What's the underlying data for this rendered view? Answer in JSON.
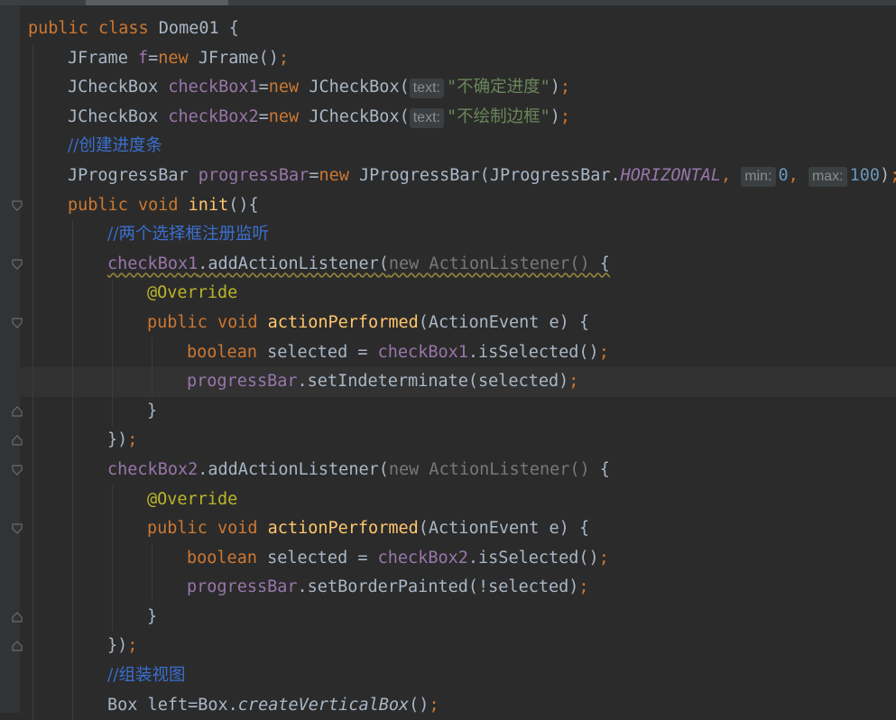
{
  "editor": {
    "lines": [
      {
        "indent": 0,
        "fold": "",
        "caret": false,
        "tokens": [
          {
            "t": "public ",
            "c": "kw"
          },
          {
            "t": "class ",
            "c": "kw"
          },
          {
            "t": "Dome01 {",
            "c": ""
          }
        ]
      },
      {
        "indent": 1,
        "fold": "",
        "caret": false,
        "tokens": [
          {
            "t": "JFrame ",
            "c": ""
          },
          {
            "t": "f",
            "c": "fld"
          },
          {
            "t": "=",
            "c": ""
          },
          {
            "t": "new ",
            "c": "kw"
          },
          {
            "t": "JFrame()",
            "c": ""
          },
          {
            "t": ";",
            "c": "kw"
          }
        ]
      },
      {
        "indent": 1,
        "fold": "",
        "caret": false,
        "tokens": [
          {
            "t": "JCheckBox ",
            "c": ""
          },
          {
            "t": "checkBox1",
            "c": "fld"
          },
          {
            "t": "=",
            "c": ""
          },
          {
            "t": "new ",
            "c": "kw"
          },
          {
            "t": "JCheckBox(",
            "c": ""
          },
          {
            "t": "text:",
            "c": "hint"
          },
          {
            "t": "\"不确定进度\"",
            "c": "str"
          },
          {
            "t": ")",
            "c": ""
          },
          {
            "t": ";",
            "c": "kw"
          }
        ]
      },
      {
        "indent": 1,
        "fold": "",
        "caret": false,
        "tokens": [
          {
            "t": "JCheckBox ",
            "c": ""
          },
          {
            "t": "checkBox2",
            "c": "fld"
          },
          {
            "t": "=",
            "c": ""
          },
          {
            "t": "new ",
            "c": "kw"
          },
          {
            "t": "JCheckBox(",
            "c": ""
          },
          {
            "t": "text:",
            "c": "hint"
          },
          {
            "t": "\"不绘制边框\"",
            "c": "str"
          },
          {
            "t": ")",
            "c": ""
          },
          {
            "t": ";",
            "c": "kw"
          }
        ]
      },
      {
        "indent": 1,
        "fold": "",
        "caret": false,
        "tokens": [
          {
            "t": "//",
            "c": "cmt"
          },
          {
            "t": "创建进度条",
            "c": "cmt"
          }
        ]
      },
      {
        "indent": 1,
        "fold": "",
        "caret": false,
        "tokens": [
          {
            "t": "JProgressBar ",
            "c": ""
          },
          {
            "t": "progressBar",
            "c": "fld"
          },
          {
            "t": "=",
            "c": ""
          },
          {
            "t": "new ",
            "c": "kw"
          },
          {
            "t": "JProgressBar(JProgressBar.",
            "c": ""
          },
          {
            "t": "HORIZONTAL",
            "c": "fld ital"
          },
          {
            "t": ", ",
            "c": "kw"
          },
          {
            "t": "min:",
            "c": "hint"
          },
          {
            "t": "0",
            "c": "num"
          },
          {
            "t": ", ",
            "c": "kw"
          },
          {
            "t": "max:",
            "c": "hint"
          },
          {
            "t": "100",
            "c": "num"
          },
          {
            "t": ")",
            "c": ""
          },
          {
            "t": ";",
            "c": "kw"
          }
        ]
      },
      {
        "indent": 1,
        "fold": "open",
        "caret": false,
        "tokens": [
          {
            "t": "public ",
            "c": "kw"
          },
          {
            "t": "void ",
            "c": "kw"
          },
          {
            "t": "init",
            "c": "fn"
          },
          {
            "t": "(){",
            "c": ""
          }
        ]
      },
      {
        "indent": 2,
        "fold": "",
        "caret": false,
        "tokens": [
          {
            "t": "//",
            "c": "cmt"
          },
          {
            "t": "两个选择框注册监听",
            "c": "cmt"
          }
        ]
      },
      {
        "indent": 2,
        "fold": "open",
        "caret": false,
        "tokens": [
          {
            "t": "checkBox1",
            "c": "fld warn"
          },
          {
            "t": ".addActionListener(",
            "c": "warn"
          },
          {
            "t": "new ActionListener() ",
            "c": "grey warn"
          },
          {
            "t": "{",
            "c": "warn"
          }
        ]
      },
      {
        "indent": 3,
        "fold": "",
        "caret": false,
        "tokens": [
          {
            "t": "@Override",
            "c": "ann"
          }
        ]
      },
      {
        "indent": 3,
        "fold": "open",
        "caret": false,
        "tokens": [
          {
            "t": "public ",
            "c": "kw"
          },
          {
            "t": "void ",
            "c": "kw"
          },
          {
            "t": "actionPerformed",
            "c": "fn"
          },
          {
            "t": "(ActionEvent e) {",
            "c": ""
          }
        ]
      },
      {
        "indent": 4,
        "fold": "",
        "caret": false,
        "tokens": [
          {
            "t": "boolean ",
            "c": "kw"
          },
          {
            "t": "selected = ",
            "c": ""
          },
          {
            "t": "checkBox1",
            "c": "fld"
          },
          {
            "t": ".isSelected()",
            "c": ""
          },
          {
            "t": ";",
            "c": "kw"
          }
        ]
      },
      {
        "indent": 4,
        "fold": "",
        "caret": true,
        "tokens": [
          {
            "t": "progressBar",
            "c": "fld"
          },
          {
            "t": ".setIndeterminate(selected)",
            "c": ""
          },
          {
            "t": ";",
            "c": "kw"
          }
        ]
      },
      {
        "indent": 3,
        "fold": "close",
        "caret": false,
        "tokens": [
          {
            "t": "}",
            "c": ""
          }
        ]
      },
      {
        "indent": 2,
        "fold": "close",
        "caret": false,
        "tokens": [
          {
            "t": "})",
            "c": ""
          },
          {
            "t": ";",
            "c": "kw"
          }
        ]
      },
      {
        "indent": 2,
        "fold": "open",
        "caret": false,
        "tokens": [
          {
            "t": "checkBox2",
            "c": "fld"
          },
          {
            "t": ".addActionListener(",
            "c": ""
          },
          {
            "t": "new ActionListener() ",
            "c": "grey"
          },
          {
            "t": "{",
            "c": ""
          }
        ]
      },
      {
        "indent": 3,
        "fold": "",
        "caret": false,
        "tokens": [
          {
            "t": "@Override",
            "c": "ann"
          }
        ]
      },
      {
        "indent": 3,
        "fold": "open",
        "caret": false,
        "tokens": [
          {
            "t": "public ",
            "c": "kw"
          },
          {
            "t": "void ",
            "c": "kw"
          },
          {
            "t": "actionPerformed",
            "c": "fn"
          },
          {
            "t": "(ActionEvent e) {",
            "c": ""
          }
        ]
      },
      {
        "indent": 4,
        "fold": "",
        "caret": false,
        "tokens": [
          {
            "t": "boolean ",
            "c": "kw"
          },
          {
            "t": "selected = ",
            "c": ""
          },
          {
            "t": "checkBox2",
            "c": "fld"
          },
          {
            "t": ".isSelected()",
            "c": ""
          },
          {
            "t": ";",
            "c": "kw"
          }
        ]
      },
      {
        "indent": 4,
        "fold": "",
        "caret": false,
        "tokens": [
          {
            "t": "progressBar",
            "c": "fld"
          },
          {
            "t": ".setBorderPainted(!selected)",
            "c": ""
          },
          {
            "t": ";",
            "c": "kw"
          }
        ]
      },
      {
        "indent": 3,
        "fold": "close",
        "caret": false,
        "tokens": [
          {
            "t": "}",
            "c": ""
          }
        ]
      },
      {
        "indent": 2,
        "fold": "close",
        "caret": false,
        "tokens": [
          {
            "t": "})",
            "c": ""
          },
          {
            "t": ";",
            "c": "kw"
          }
        ]
      },
      {
        "indent": 2,
        "fold": "",
        "caret": false,
        "tokens": [
          {
            "t": "//",
            "c": "cmt"
          },
          {
            "t": "组装视图",
            "c": "cmt"
          }
        ]
      },
      {
        "indent": 2,
        "fold": "",
        "caret": false,
        "tokens": [
          {
            "t": "Box left=Box.",
            "c": ""
          },
          {
            "t": "createVerticalBox",
            "c": "ital"
          },
          {
            "t": "()",
            "c": ""
          },
          {
            "t": ";",
            "c": "kw"
          }
        ]
      }
    ]
  }
}
